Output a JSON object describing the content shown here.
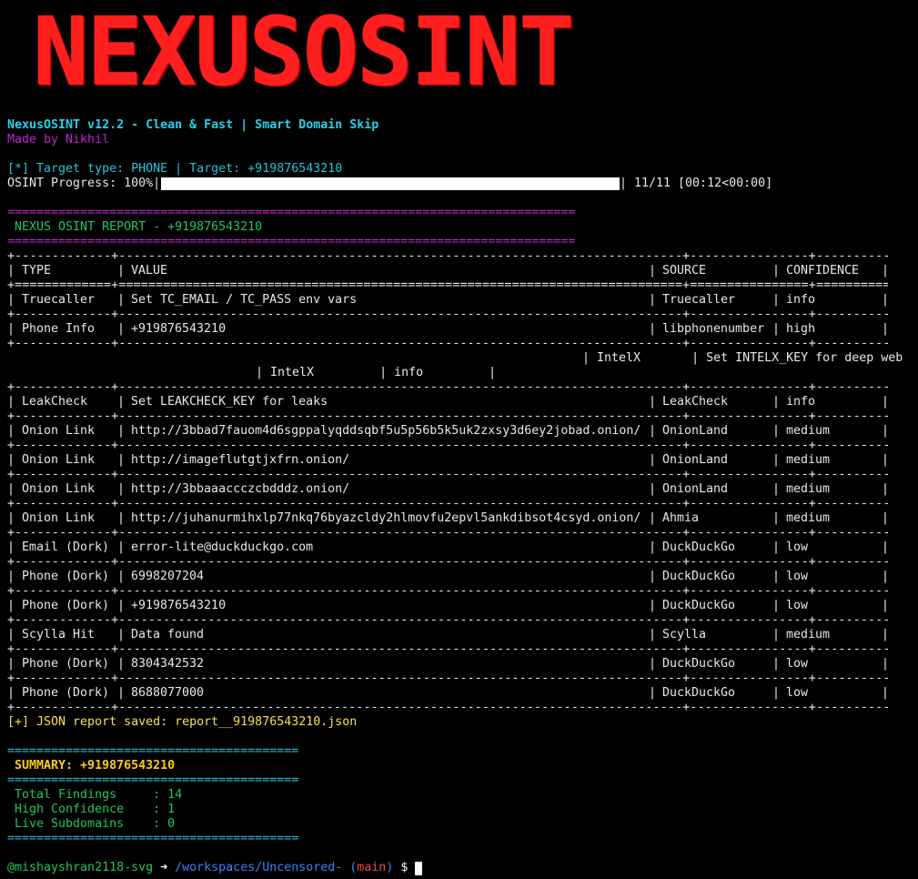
{
  "banner": {
    "text": "NEXUSOSINT"
  },
  "header": {
    "version_line": "NexusOSINT v12.2 - Clean & Fast | Smart Domain Skip",
    "author_line": "Made by Nikhil"
  },
  "target_line": "[*] Target type: PHONE | Target: +919876543210",
  "progress": {
    "label": "OSINT Progress: 100%|",
    "percent": 100,
    "suffix": "| 11/11 [00:12<00:00]"
  },
  "report": {
    "equals_rule": "==============================================================================",
    "title": " NEXUS OSINT REPORT - +919876543210"
  },
  "table": {
    "columns": [
      "TYPE",
      "VALUE",
      "SOURCE",
      "CONFIDENCE"
    ],
    "rows": [
      {
        "type": "Truecaller",
        "value": "Set TC_EMAIL / TC_PASS env vars",
        "source": "Truecaller",
        "confidence": "info"
      },
      {
        "type": "Phone Info",
        "value": "+919876543210",
        "source": "libphonenumber",
        "confidence": "high"
      },
      {
        "type": "LeakCheck",
        "value": "Set LEAKCHECK_KEY for leaks",
        "source": "LeakCheck",
        "confidence": "info"
      },
      {
        "type": "Onion Link",
        "value": "http://3bbad7fauom4d6sgppalyqddsqbf5u5p56b5k5uk2zxsy3d6ey2jobad.onion/",
        "source": "OnionLand",
        "confidence": "medium"
      },
      {
        "type": "Onion Link",
        "value": "http://imageflutgtjxfrn.onion/",
        "source": "OnionLand",
        "confidence": "medium"
      },
      {
        "type": "Onion Link",
        "value": "http://3bbaaaccczcbdddz.onion/",
        "source": "OnionLand",
        "confidence": "medium"
      },
      {
        "type": "Onion Link",
        "value": "http://juhanurmihxlp77nkq76byazcldy2hlmovfu2epvl5ankdibsot4csyd.onion/",
        "source": "Ahmia",
        "confidence": "medium"
      },
      {
        "type": "Email (Dork)",
        "value": "error-lite@duckduckgo.com",
        "source": "DuckDuckGo",
        "confidence": "low"
      },
      {
        "type": "Phone (Dork)",
        "value": "6998207204",
        "source": "DuckDuckGo",
        "confidence": "low"
      },
      {
        "type": "Phone (Dork)",
        "value": "+919876543210",
        "source": "DuckDuckGo",
        "confidence": "low"
      },
      {
        "type": "Scylla Hit",
        "value": "Data found",
        "source": "Scylla",
        "confidence": "medium"
      },
      {
        "type": "Phone (Dork)",
        "value": "8304342532",
        "source": "DuckDuckGo",
        "confidence": "low"
      },
      {
        "type": "Phone (Dork)",
        "value": "8688077000",
        "source": "DuckDuckGo",
        "confidence": "low"
      }
    ],
    "wrapped_row": {
      "line1": "| IntelX       | Set INTELX_KEY for deep web",
      "line2": "| IntelX         | info         |"
    }
  },
  "saved_line": "[+] JSON report saved: report__919876543210.json",
  "summary": {
    "rule": "========================================",
    "title": " SUMMARY: +919876543210",
    "lines": [
      " Total Findings     : 14",
      " High Confidence    : 1",
      " Live Subdomains    : 0"
    ]
  },
  "prompt": {
    "user": "@mishayshran2118-svg",
    "arrow": " ➜ ",
    "path": "/workspaces/Uncensored-",
    "branch_open": " (",
    "branch": "main",
    "branch_close": ")",
    "dollar": " $ "
  },
  "colors": {
    "banner": "#ff1f1f",
    "cyan": "#22d3ee",
    "magenta": "#c026d3",
    "green": "#22c55e",
    "yellow": "#fde047",
    "prompt_blue": "#3b82f6",
    "prompt_red": "#ef4444"
  }
}
